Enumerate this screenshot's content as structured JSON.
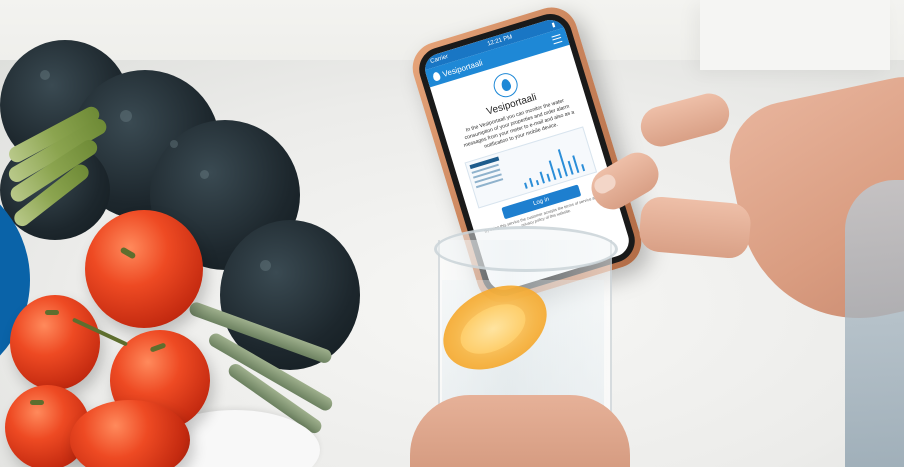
{
  "phone_screen": {
    "status_left": "Carrier",
    "status_center": "12:21 PM",
    "app_name": "Vesiportaali",
    "title": "Vesiportaali",
    "description": "In the Vesiportaali you can monitor the water consumption of your properties and order alarm messages from your meter to e-mail and also as a notification to your mobile device.",
    "login_label": "Log in",
    "fine_print": "By using this service the customer accepts the terms of service and the privacy policy of this website."
  },
  "colors": {
    "accent_blue": "#1e88d6",
    "arc_blue": "#0a63a8",
    "case_copper": "#c8825a"
  }
}
